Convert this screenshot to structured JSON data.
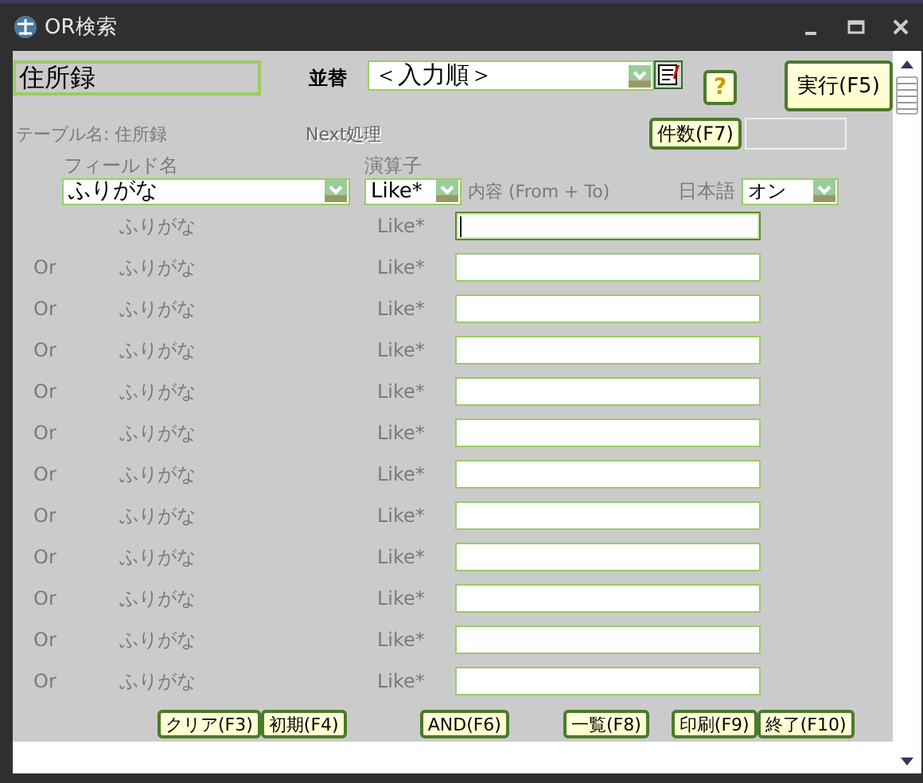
{
  "window": {
    "title": "OR検索"
  },
  "table_box": "住所録",
  "sort": {
    "label": "並替",
    "value": "＜入力順＞"
  },
  "help_button": "?",
  "execute_button": "実行(F5)",
  "table_name": "テーブル名: 住所録",
  "next_label": "Next処理",
  "count_button": "件数(F7)",
  "field_label": "フィールド名",
  "operator_label": "演算子",
  "field_select": "ふりがな",
  "operator_select": "Like*",
  "content_label": "内容 (From + To)",
  "japanese": {
    "label": "日本語",
    "value": "オン"
  },
  "conditions": [
    {
      "field": "ふりがな",
      "operator": "Like*",
      "focused": true
    },
    {
      "conjunction": "Or",
      "field": "ふりがな",
      "operator": "Like*",
      "focused": false
    },
    {
      "conjunction": "Or",
      "field": "ふりがな",
      "operator": "Like*",
      "focused": false
    },
    {
      "conjunction": "Or",
      "field": "ふりがな",
      "operator": "Like*",
      "focused": false
    },
    {
      "conjunction": "Or",
      "field": "ふりがな",
      "operator": "Like*",
      "focused": false
    },
    {
      "conjunction": "Or",
      "field": "ふりがな",
      "operator": "Like*",
      "focused": false
    },
    {
      "conjunction": "Or",
      "field": "ふりがな",
      "operator": "Like*",
      "focused": false
    },
    {
      "conjunction": "Or",
      "field": "ふりがな",
      "operator": "Like*",
      "focused": false
    },
    {
      "conjunction": "Or",
      "field": "ふりがな",
      "operator": "Like*",
      "focused": false
    },
    {
      "conjunction": "Or",
      "field": "ふりがな",
      "operator": "Like*",
      "focused": false
    },
    {
      "conjunction": "Or",
      "field": "ふりがな",
      "operator": "Like*",
      "focused": false
    },
    {
      "conjunction": "Or",
      "field": "ふりがな",
      "operator": "Like*",
      "focused": false
    }
  ],
  "buttons": [
    "クリア(F3)",
    "初期(F4)",
    "AND(F6)",
    "一覧(F8)",
    "印刷(F9)",
    "終了(F10)"
  ]
}
